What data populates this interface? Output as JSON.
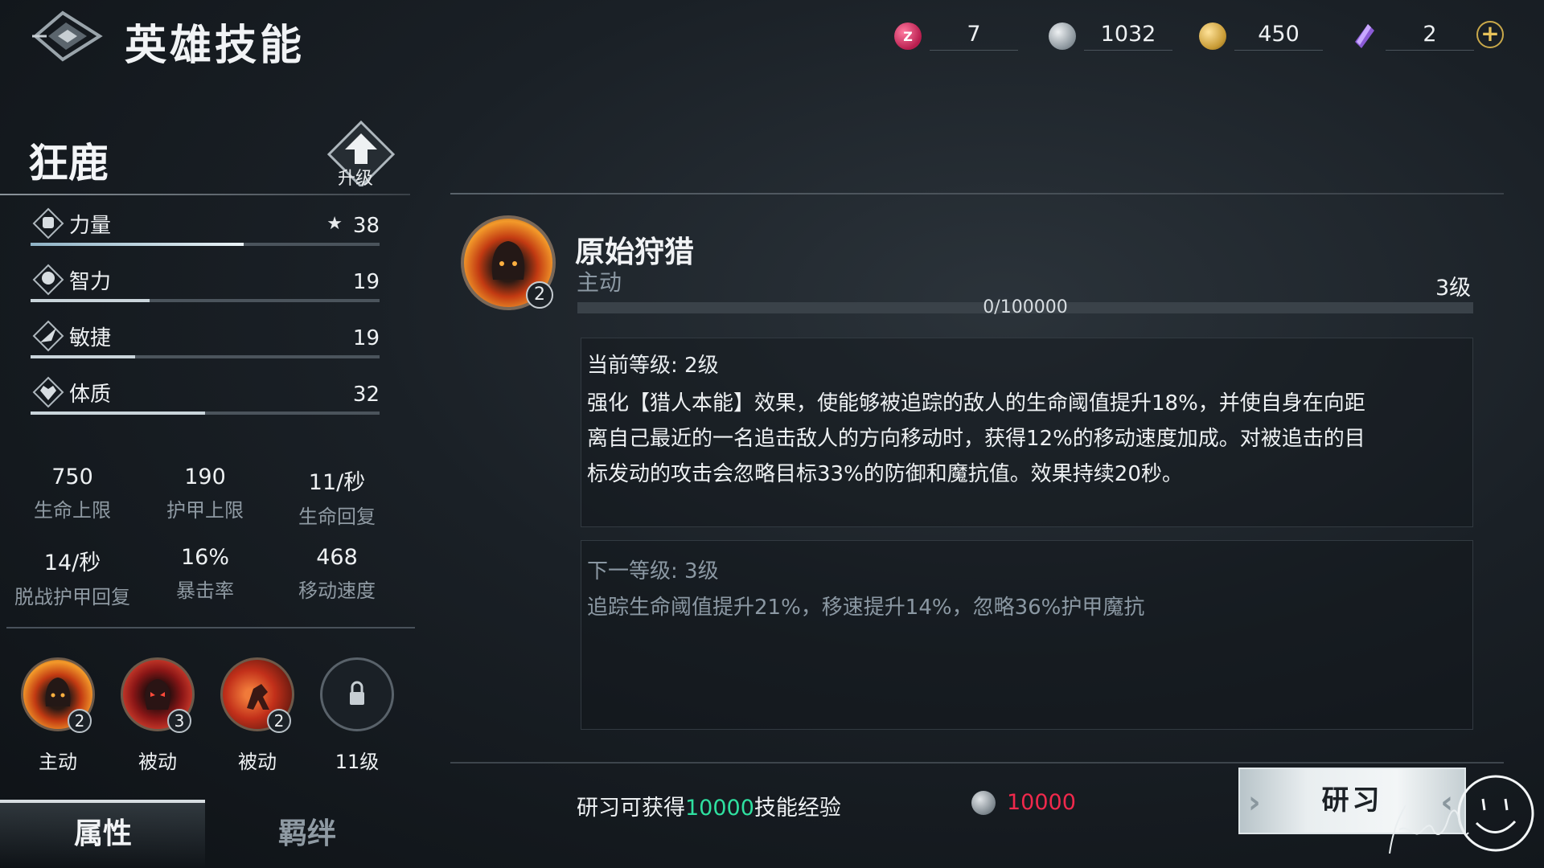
{
  "header": {
    "title": "英雄技能",
    "currencies": [
      {
        "icon": "ticket-gem-icon",
        "value": "7",
        "color": "#d4386a"
      },
      {
        "icon": "silver-coin-icon",
        "value": "1032",
        "color": "#9aa3a9"
      },
      {
        "icon": "gold-coin-icon",
        "value": "450",
        "color": "#c89b35"
      },
      {
        "icon": "purple-crystal-icon",
        "value": "2",
        "color": "#8b5bd6"
      }
    ],
    "add_icon": "plus-icon"
  },
  "hero": {
    "name": "狂鹿",
    "upgrade_label": "升级"
  },
  "stats": [
    {
      "name": "力量",
      "value": "38",
      "starred": true,
      "fill": 0.61
    },
    {
      "name": "智力",
      "value": "19",
      "starred": false,
      "fill": 0.34
    },
    {
      "name": "敏捷",
      "value": "19",
      "starred": false,
      "fill": 0.3
    },
    {
      "name": "体质",
      "value": "32",
      "starred": false,
      "fill": 0.5
    }
  ],
  "attributes": [
    {
      "value": "750",
      "label": "生命上限"
    },
    {
      "value": "190",
      "label": "护甲上限"
    },
    {
      "value": "11/秒",
      "label": "生命回复"
    },
    {
      "value": "14/秒",
      "label": "脱战护甲回复"
    },
    {
      "value": "16%",
      "label": "暴击率"
    },
    {
      "value": "468",
      "label": "移动速度"
    }
  ],
  "skills": [
    {
      "label": "主动",
      "level": "2",
      "icon": "hooded-flame-skill-icon"
    },
    {
      "label": "被动",
      "level": "3",
      "icon": "demon-face-skill-icon"
    },
    {
      "label": "被动",
      "level": "2",
      "icon": "charging-figure-skill-icon"
    },
    {
      "label": "11级",
      "level": null,
      "icon": "lock-icon"
    }
  ],
  "tabs": [
    {
      "label": "属性",
      "active": true
    },
    {
      "label": "羁绊",
      "active": false
    }
  ],
  "detail": {
    "skill_name": "原始狩猎",
    "skill_type": "主动",
    "skill_level": "3级",
    "badge_level": "2",
    "exp_text": "0/100000",
    "exp_fraction": 0,
    "current": {
      "heading": "当前等级: 2级",
      "lines": [
        "强化【猎人本能】效果，使能够被追踪的敌人的生命阈值提升18%，并使自身在向距",
        "离自己最近的一名追击敌人的方向移动时，获得12%的移动速度加成。对被追击的目",
        "标发动的攻击会忽略目标33%的防御和魔抗值。效果持续20秒。"
      ]
    },
    "next": {
      "heading": "下一等级: 3级",
      "lines": [
        "追踪生命阈值提升21%，移速提升14%，忽略36%护甲魔抗"
      ]
    }
  },
  "footer": {
    "learn_prefix": "研习可获得",
    "learn_amount": "10000",
    "learn_suffix": "技能经验",
    "cost": "10000",
    "button_label": "研习"
  }
}
